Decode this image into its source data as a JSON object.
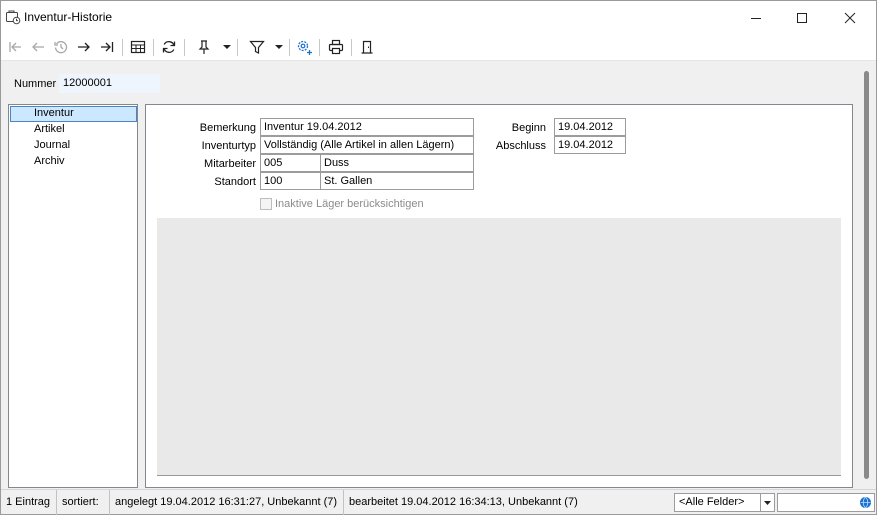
{
  "window": {
    "title": "Inventur-Historie",
    "icons": {
      "app": "inventory-history-icon",
      "minimize": "minimize-icon",
      "maximize": "maximize-icon",
      "close": "close-icon"
    }
  },
  "toolbar": {
    "buttons": [
      {
        "name": "first-record-icon",
        "enabled": false
      },
      {
        "name": "previous-record-icon",
        "enabled": false
      },
      {
        "name": "history-icon",
        "enabled": false
      },
      {
        "name": "next-record-icon",
        "enabled": true
      },
      {
        "name": "last-record-icon",
        "enabled": true
      },
      {
        "name": "table-view-icon",
        "enabled": true
      },
      {
        "name": "refresh-icon",
        "enabled": true
      },
      {
        "name": "pin-icon",
        "enabled": true
      },
      {
        "name": "filter-icon",
        "enabled": true
      },
      {
        "name": "settings-icon",
        "enabled": true
      },
      {
        "name": "print-icon",
        "enabled": true
      },
      {
        "name": "exit-door-icon",
        "enabled": true
      }
    ]
  },
  "record": {
    "number_label": "Nummer",
    "number_value": "12000001"
  },
  "nav": {
    "items": [
      {
        "label": "Inventur",
        "selected": true
      },
      {
        "label": "Artikel",
        "selected": false
      },
      {
        "label": "Journal",
        "selected": false
      },
      {
        "label": "Archiv",
        "selected": false
      }
    ]
  },
  "form": {
    "bemerkung_label": "Bemerkung",
    "bemerkung_value": "Inventur 19.04.2012",
    "inventurtyp_label": "Inventurtyp",
    "inventurtyp_value": "Vollständig (Alle Artikel in allen Lägern)",
    "mitarbeiter_label": "Mitarbeiter",
    "mitarbeiter_code": "005",
    "mitarbeiter_name": "Duss",
    "standort_label": "Standort",
    "standort_code": "100",
    "standort_name": "St. Gallen",
    "beginn_label": "Beginn",
    "beginn_value": "19.04.2012",
    "abschluss_label": "Abschluss",
    "abschluss_value": "19.04.2012",
    "inaktive_label": "Inaktive Läger berücksichtigen",
    "inaktive_checked": false
  },
  "status": {
    "count": "1 Eintrag",
    "sorted": "sortiert:",
    "created": "angelegt 19.04.2012 16:31:27, Unbekannt (7)",
    "edited": "bearbeitet 19.04.2012 16:34:13, Unbekannt (7)",
    "field_filter": "<Alle Felder>",
    "search_value": ""
  },
  "colors": {
    "selection_bg": "#cce8ff",
    "selection_border": "#4f84c4",
    "accent_icon": "#1a6fd1"
  }
}
